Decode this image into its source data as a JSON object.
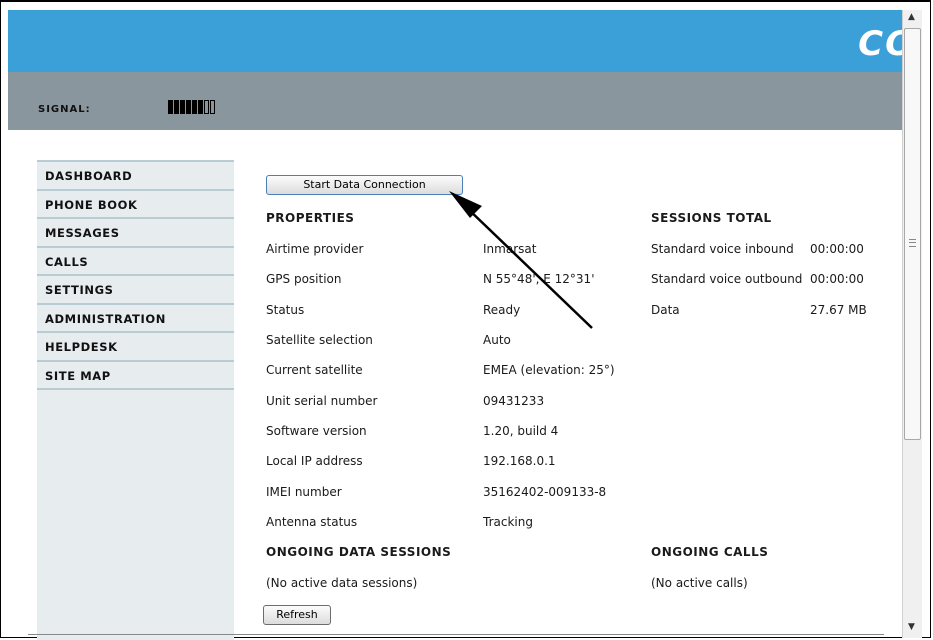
{
  "header": {
    "logo_text": "CO"
  },
  "signal": {
    "label": "SIGNAL:",
    "bars_total": 8,
    "bars_filled": 6
  },
  "sidebar": {
    "items": [
      {
        "label": "DASHBOARD"
      },
      {
        "label": "PHONE BOOK"
      },
      {
        "label": "MESSAGES"
      },
      {
        "label": "CALLS"
      },
      {
        "label": "SETTINGS"
      },
      {
        "label": "ADMINISTRATION"
      },
      {
        "label": "HELPDESK"
      },
      {
        "label": "SITE MAP"
      }
    ]
  },
  "main": {
    "start_button": "Start Data Connection",
    "properties_title": "PROPERTIES",
    "properties": [
      {
        "label": "Airtime provider",
        "value": "Inmarsat"
      },
      {
        "label": "GPS position",
        "value": "N 55°48', E 12°31'"
      },
      {
        "label": "Status",
        "value": "Ready"
      },
      {
        "label": "Satellite selection",
        "value": "Auto"
      },
      {
        "label": "Current satellite",
        "value": "EMEA (elevation: 25°)"
      },
      {
        "label": "Unit serial number",
        "value": "09431233"
      },
      {
        "label": "Software version",
        "value": "1.20, build 4"
      },
      {
        "label": "Local IP address",
        "value": "192.168.0.1"
      },
      {
        "label": "IMEI number",
        "value": "35162402-009133-8"
      },
      {
        "label": "Antenna status",
        "value": "Tracking"
      }
    ],
    "sessions_title": "SESSIONS TOTAL",
    "sessions": [
      {
        "label": "Standard voice inbound",
        "value": "00:00:00"
      },
      {
        "label": "Standard voice outbound",
        "value": "00:00:00"
      },
      {
        "label": "Data",
        "value": "27.67 MB"
      }
    ],
    "ongoing_data_title": "ONGOING DATA SESSIONS",
    "ongoing_data_text": "(No active data sessions)",
    "ongoing_calls_title": "ONGOING CALLS",
    "ongoing_calls_text": "(No active calls)",
    "refresh_button": "Refresh"
  },
  "colors": {
    "header_blue": "#3b9fd8",
    "signal_gray": "#8a969e",
    "sidebar_bg": "#e7ecef"
  }
}
